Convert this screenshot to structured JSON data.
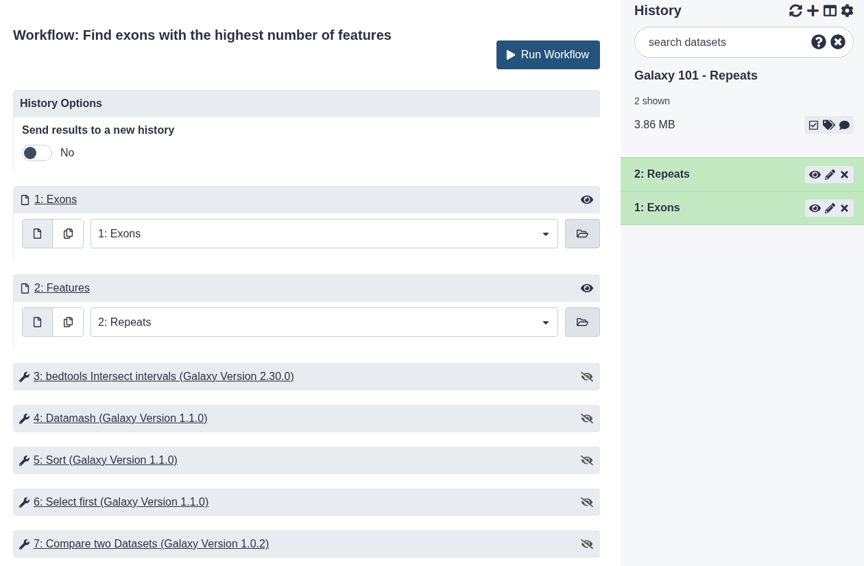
{
  "workflow": {
    "title": "Workflow: Find exons with the highest number of features",
    "run_button": "Run Workflow"
  },
  "history_options": {
    "title": "History Options",
    "label": "Send results to a new history",
    "on": false,
    "value": "No"
  },
  "steps": [
    {
      "kind": "input",
      "title": "1: Exons",
      "visible": true,
      "value": "1: Exons"
    },
    {
      "kind": "input",
      "title": "2: Features",
      "visible": true,
      "value": "2: Repeats"
    },
    {
      "kind": "tool",
      "title": "3: bedtools Intersect intervals (Galaxy Version 2.30.0)",
      "visible": false
    },
    {
      "kind": "tool",
      "title": "4: Datamash (Galaxy Version 1.1.0)",
      "visible": false
    },
    {
      "kind": "tool",
      "title": "5: Sort (Galaxy Version 1.1.0)",
      "visible": false
    },
    {
      "kind": "tool",
      "title": "6: Select first (Galaxy Version 1.1.0)",
      "visible": false
    },
    {
      "kind": "tool",
      "title": "7: Compare two Datasets (Galaxy Version 1.0.2)",
      "visible": false
    }
  ],
  "history": {
    "title": "History",
    "search": {
      "placeholder": "search datasets"
    },
    "name": "Galaxy 101 - Repeats",
    "shown": "2 shown",
    "size": "3.86 MB",
    "datasets": [
      {
        "name": "2: Repeats",
        "color": "#c3e9c3"
      },
      {
        "name": "1: Exons",
        "color": "#c3e9c3"
      }
    ]
  }
}
